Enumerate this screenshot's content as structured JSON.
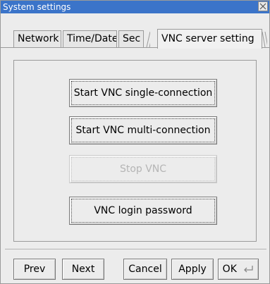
{
  "window": {
    "title": "System settings"
  },
  "tabs": [
    {
      "label": "Network"
    },
    {
      "label": "Time/Date"
    },
    {
      "label": "Sec"
    },
    {
      "label": "VNC server setting"
    }
  ],
  "actions": {
    "start_single": "Start VNC single-connection",
    "start_multi": "Start VNC multi-connection",
    "stop": "Stop VNC",
    "login_password": "VNC login password"
  },
  "footer": {
    "prev": "Prev",
    "next": "Next",
    "cancel": "Cancel",
    "apply": "Apply",
    "ok": "OK"
  },
  "icons": {
    "close": "close-icon",
    "enter": "enter-icon"
  }
}
